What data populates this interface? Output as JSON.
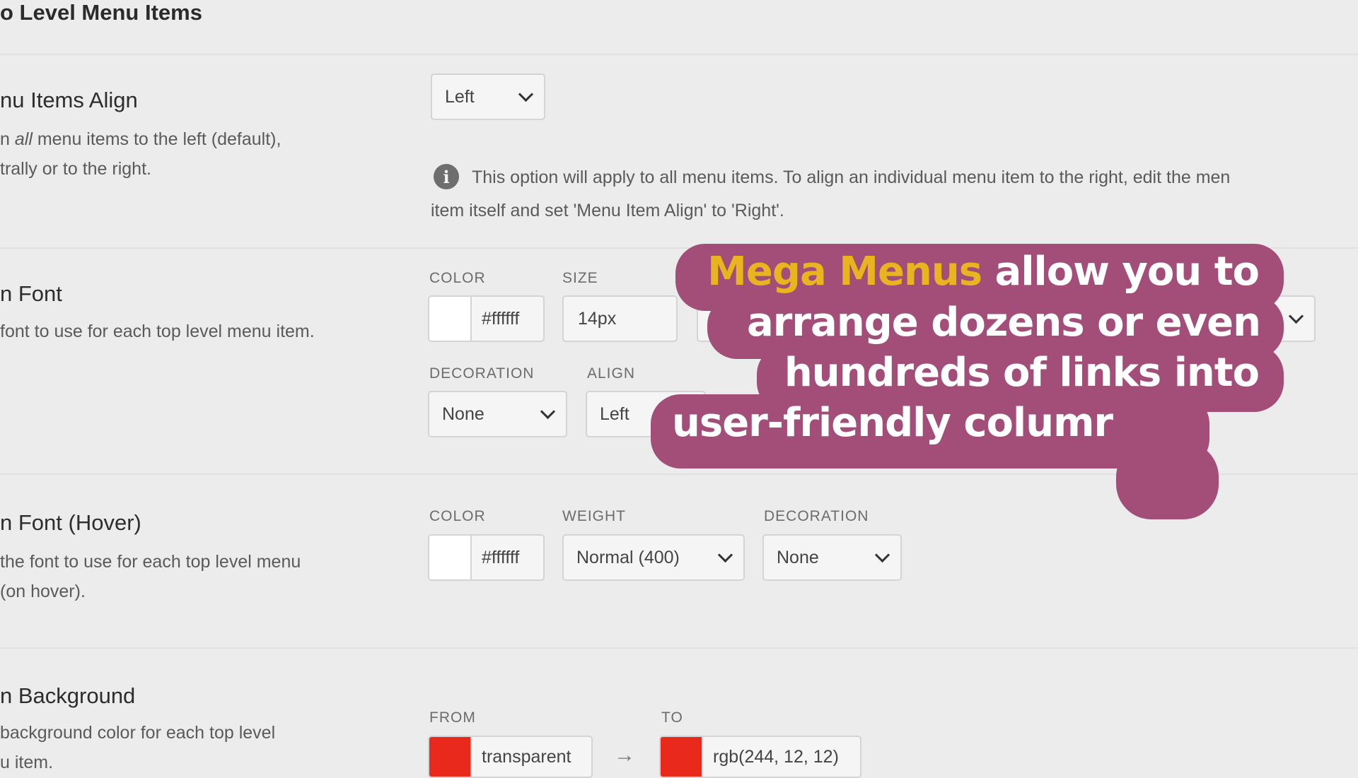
{
  "section": {
    "title": "o Level Menu Items"
  },
  "rows": {
    "align": {
      "heading": "nu Items Align",
      "desc_pre": "n ",
      "desc_em": "all",
      "desc_post": " menu items to the left (default),",
      "desc2": "trally or to the right.",
      "select_value": "Left",
      "info_line1": "This option will apply to all menu items. To align an individual menu item to the right, edit the men",
      "info_line2": "item itself and set 'Menu Item Align' to 'Right'."
    },
    "font": {
      "heading": "n Font",
      "desc": "font to use for each top level menu item.",
      "labels": {
        "color": "COLOR",
        "size": "SIZE",
        "decoration": "DECORATION",
        "align": "ALIGN"
      },
      "color_value": "#ffffff",
      "size_value": "14px",
      "decoration_value": "None",
      "align_value": "Left"
    },
    "hover": {
      "heading": "n Font (Hover)",
      "desc1": "the font to use for each top level menu",
      "desc2": " (on hover).",
      "labels": {
        "color": "COLOR",
        "weight": "WEIGHT",
        "decoration": "DECORATION"
      },
      "color_value": "#ffffff",
      "weight_value": "Normal (400)",
      "decoration_value": "None"
    },
    "background": {
      "heading": "n Background",
      "desc1": "background color for each top level",
      "desc2": "u item.",
      "labels": {
        "from": "FROM",
        "to": "TO"
      },
      "from_value": "transparent",
      "to_value": "rgb(244, 12, 12)",
      "arrow": "→"
    }
  },
  "caption": {
    "highlight": "Mega Menus",
    "line1_rest": " allow you to",
    "line2": "arrange dozens or even",
    "line3": "hundreds of links into",
    "line4": "user-friendly columr"
  },
  "colors": {
    "caption_bg": "#a34e78",
    "caption_highlight": "#e7b51f",
    "caption_text": "#ffffff",
    "swatch_white": "#ffffff",
    "swatch_from": "#e8291c",
    "swatch_to": "#e8291c"
  },
  "icons": {
    "info": "info-icon",
    "dropdown": "chevron-down-icon",
    "arrow": "arrow-right-icon"
  }
}
